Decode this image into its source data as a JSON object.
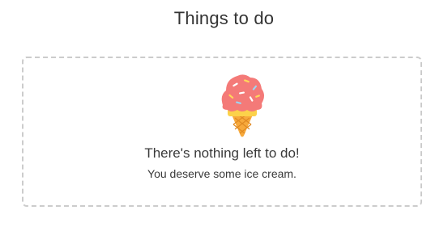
{
  "header": {
    "title": "Things to do"
  },
  "empty_state": {
    "icon": "ice-cream-cone-icon",
    "message": "There's nothing left to do!",
    "submessage": "You deserve some ice cream."
  },
  "colors": {
    "scoop": "#f47a78",
    "cone": "#f7a93b",
    "cone_rim": "#fcd24a",
    "border": "#cccccc",
    "text": "#333333"
  }
}
